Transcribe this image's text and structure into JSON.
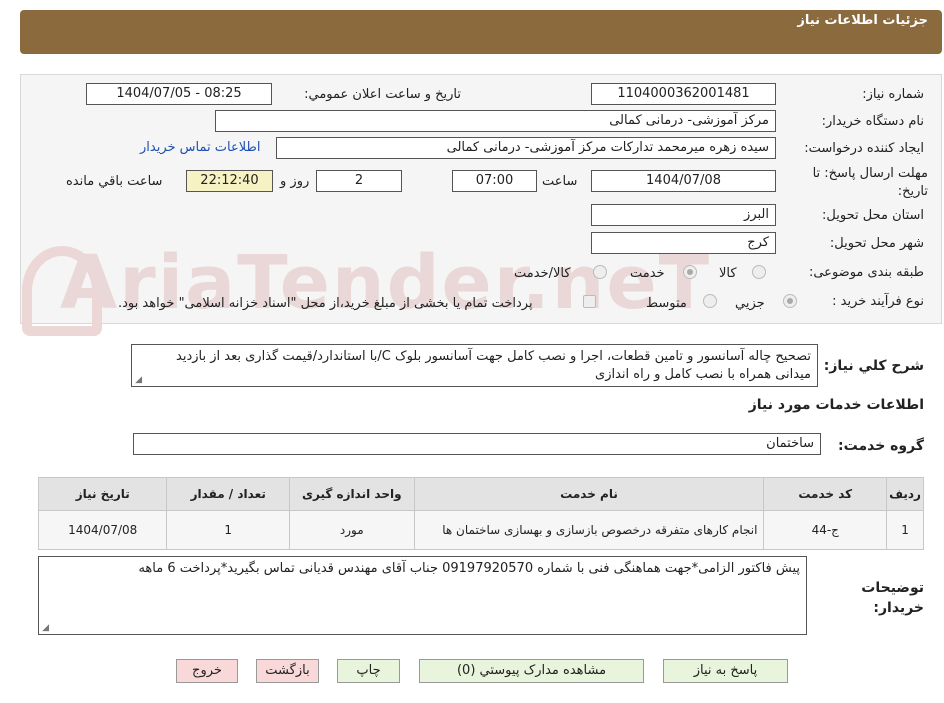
{
  "header": {
    "title": "جزئیات اطلاعات نیاز"
  },
  "form": {
    "need_number": {
      "label": "شماره نیاز:",
      "value": "1104000362001481"
    },
    "announce_datetime": {
      "label": "تاریخ و ساعت اعلان عمومي:",
      "value": "1404/07/05 - 08:25"
    },
    "buyer_org": {
      "label": "نام دستگاه خريدار:",
      "value": "مرکز آموزشی- درمانی کمالی"
    },
    "requester": {
      "label": "ايجاد کننده درخواست:",
      "value": "سیده زهره میرمحمد تدارکات مرکز آموزشی- درمانی کمالی",
      "contact_link": "اطلاعات تماس خريدار"
    },
    "deadline": {
      "label": "مهلت ارسال پاسخ: تا تاريخ:",
      "date": "1404/07/08",
      "time_label": "ساعت",
      "time": "07:00",
      "days": "2",
      "days_label": "روز و",
      "remaining": "22:12:40",
      "remaining_label": "ساعت باقي مانده"
    },
    "province": {
      "label": "استان محل تحويل:",
      "value": "البرز"
    },
    "city": {
      "label": "شهر محل تحويل:",
      "value": "کرج"
    },
    "category": {
      "label": "طبقه بندی موضوعی:",
      "options": [
        "کالا",
        "خدمت",
        "کالا/خدمت"
      ]
    },
    "purchase_type": {
      "label": "نوع فرآيند خريد :",
      "options": [
        "جزيي",
        "متوسط"
      ],
      "treasury_note": "پرداخت تمام یا بخشی از مبلغ خرید،از محل \"اسناد خزانه اسلامی\" خواهد بود."
    }
  },
  "description": {
    "label": "شرح کلي نياز:",
    "text": "تصحیح چاله آسانسور و تامین قطعات، اجرا و نصب کامل جهت آسانسور بلوک C/با استاندارد/قیمت گذاری بعد از بازدید میدانی همراه با نصب کامل و راه اندازی"
  },
  "services": {
    "title": "اطلاعات خدمات مورد نياز",
    "group_label": "گروه خدمت:",
    "group_value": "ساختمان",
    "columns": [
      "رديف",
      "کد خدمت",
      "نام خدمت",
      "واحد اندازه گيری",
      "تعداد / مقدار",
      "تاريخ نياز"
    ],
    "rows": [
      [
        "1",
        "ج-44",
        "انجام کارهای متفرقه درخصوص بازسازی و بهسازی ساختمان ها",
        "مورد",
        "1",
        "1404/07/08"
      ]
    ]
  },
  "buyer_notes": {
    "label": "توضيحات خريدار:",
    "text": "پیش فاکتور الزامی*جهت هماهنگی فنی با شماره 09197920570 جناب آقای مهندس قدیانی تماس بگیرید*پرداخت 6 ماهه"
  },
  "buttons": {
    "reply": "پاسخ به نياز",
    "attachments": "مشاهده مدارک پيوستي (0)",
    "print": "چاپ",
    "back": "بازگشت",
    "exit": "خروج"
  },
  "watermark": "AriaTender.neT",
  "colors": {
    "header_bg": "#8b6a3e",
    "link": "#1f4fb3",
    "remaining_bg": "#f7f2c4",
    "green_btn": "#e8f5dc",
    "pink_btn": "#f8d8d8"
  }
}
